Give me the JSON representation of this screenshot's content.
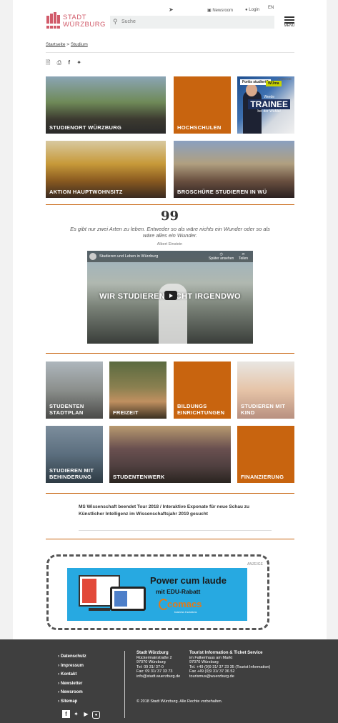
{
  "header": {
    "logo_line1": "STADT",
    "logo_line2": "WÜRZBURG",
    "newsroom": "Newsroom",
    "login": "Login",
    "lang": "EN",
    "search_placeholder": "Suche",
    "menu_label": "MENÜ"
  },
  "breadcrumb": {
    "home": "Startseite",
    "sep": ">",
    "current": "Studium"
  },
  "share_icons": [
    "document-icon",
    "print-icon",
    "facebook-icon",
    "twitter-icon"
  ],
  "tiles_top": [
    {
      "label": "STUDIENORT WÜRZBURG"
    },
    {
      "label": "HOCHSCHULEN"
    },
    {
      "ad_label": "ANZEIGE",
      "fort": "Fortis studiert?",
      "wuma": "WÜma",
      "trainee_pre": "Werde",
      "trainee": "TRAINEE",
      "trainee_post": "bei der WüMa!"
    },
    {
      "label": "AKTION HAUPTWOHNSITZ"
    },
    {
      "label": "BROSCHÜRE STUDIEREN IN WÜ"
    }
  ],
  "quote": {
    "mark": "99",
    "text": "Es gibt nur zwei Arten zu leben. Entweder so als wäre nichts ein Wunder oder so als wäre alles ein Wunder.",
    "author": "Albert Einstein"
  },
  "video": {
    "title": "Studieren und Leben in Würzburg",
    "watch_later": "Später ansehen",
    "share": "Teilen",
    "headline": "WIR STUDIEREN NICHT IRGENDWO"
  },
  "tiles_bottom": [
    {
      "label1": "STUDENTEN",
      "label2": "STADTPLAN"
    },
    {
      "label1": "FREIZEIT",
      "label2": ""
    },
    {
      "label1": "BILDUNGS",
      "label2": "EINRICHTUNGEN"
    },
    {
      "label1": "STUDIEREN MIT",
      "label2": "KIND"
    },
    {
      "label1": "STUDIEREN MIT",
      "label2": "BEHINDERUNG"
    },
    {
      "label1": "STUDENTENWERK",
      "label2": ""
    },
    {
      "label1": "FINANZIERUNG",
      "label2": ""
    }
  ],
  "news": {
    "text": "MS Wissenschaft beendet Tour 2018 / Interaktive Exponate für neue Schau zu Künstlicher Intelligenz im Wissenschaftsjahr 2019 gesucht"
  },
  "ad": {
    "label": "ANZEIGE",
    "headline": "Power cum laude",
    "sub": "mit EDU-Rabatt",
    "brand": "comacs",
    "tagline": "business it solutions"
  },
  "footer": {
    "links": [
      "Datenschutz",
      "Impressum",
      "Kontakt",
      "Newsletter",
      "Newsroom",
      "Sitemap"
    ],
    "city_title": "Stadt Würzburg",
    "city_lines": [
      "Rückermainstraße 2",
      "97070 Würzburg",
      "Tel: 09 31/ 37-0",
      "Fax: 09 31/ 37 33 73",
      "info@stadt.wuerzburg.de"
    ],
    "ti_title": "Tourist Information & Ticket Service",
    "ti_lines": [
      "im Falkenhaus am Markt",
      "97070 Würzburg",
      "Tel. +49 (0)9 31/ 37 23 35 (Tourist Information)",
      "Fax +49 (0)9 31/ 37 36 52",
      "tourismus@wuerzburg.de"
    ],
    "copyright": "© 2018 Stadt Würzburg. Alle Rechte vorbehalten."
  },
  "colors": {
    "accent": "#c8640f",
    "logo": "#d15b6a",
    "footer_bg": "#3f3f3f",
    "ad_bg": "#27a9e1"
  }
}
